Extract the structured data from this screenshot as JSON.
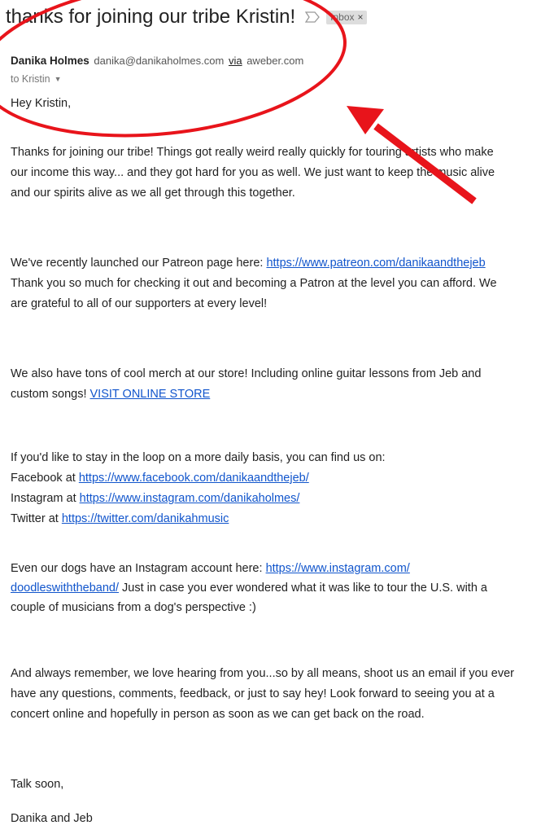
{
  "email": {
    "subject": "thanks for joining our tribe Kristin!",
    "label": "Inbox",
    "label_close": "×",
    "sender_name": "Danika Holmes",
    "sender_email": "danika@danikaholmes.com",
    "via": "via",
    "via_domain": "aweber.com",
    "to": "to Kristin",
    "greeting": "Hey Kristin,",
    "p1_l1": "Thanks for joining our tribe!  Things got really weird really quickly for touring artists who make",
    "p1_l2": "our income this way... and they got hard for you as well.  We just want to keep the music alive",
    "p1_l3": "and our spirits alive as we all get through this together.",
    "p2_l1_text": "We've recently launched our Patreon page here: ",
    "p2_l1_link": "https://www.patreon.com/danikaandthejeb",
    "p2_l2": "Thank you so much for checking it out and becoming a Patron at the level you can afford.  We",
    "p2_l3": "are grateful to all of our supporters at every level!",
    "p3_l1": "We also have tons of cool merch at our store! Including online guitar lessons from Jeb and",
    "p3_l2_text": "custom songs! ",
    "p3_l2_link": "VISIT ONLINE STORE",
    "p4_l1": "If you'd like to stay in the loop on a more daily basis, you can find us on:",
    "fb_text": "Facebook at ",
    "fb_link": "https://www.facebook.com/danikaandthejeb/",
    "ig_text": "Instagram at ",
    "ig_link": "https://www.instagram.com/danikaholmes/",
    "tw_text": "Twitter at ",
    "tw_link": "https://twitter.com/danikahmusic",
    "p5_l1_text": "Even our dogs have an Instagram account here: ",
    "p5_l1_link": "https://www.instagram.com/",
    "p5_l2_link": "doodleswiththeband/",
    "p5_l2_text": " Just in case you ever wondered what it was like to tour the U.S. with a",
    "p5_l3": "couple of musicians from a dog's perspective :)",
    "p6_l1": "And always remember, we love hearing from you...so by all means, shoot us an email if you ever",
    "p6_l2": "have any questions, comments, feedback, or just to say hey!  Look forward to seeing you at a",
    "p6_l3": "concert online and hopefully in person as soon as we can get back on the road.",
    "signoff": "Talk soon,",
    "signature": "Danika and Jeb"
  },
  "colors": {
    "annotation": "#e8141b",
    "link": "#1155cc"
  }
}
